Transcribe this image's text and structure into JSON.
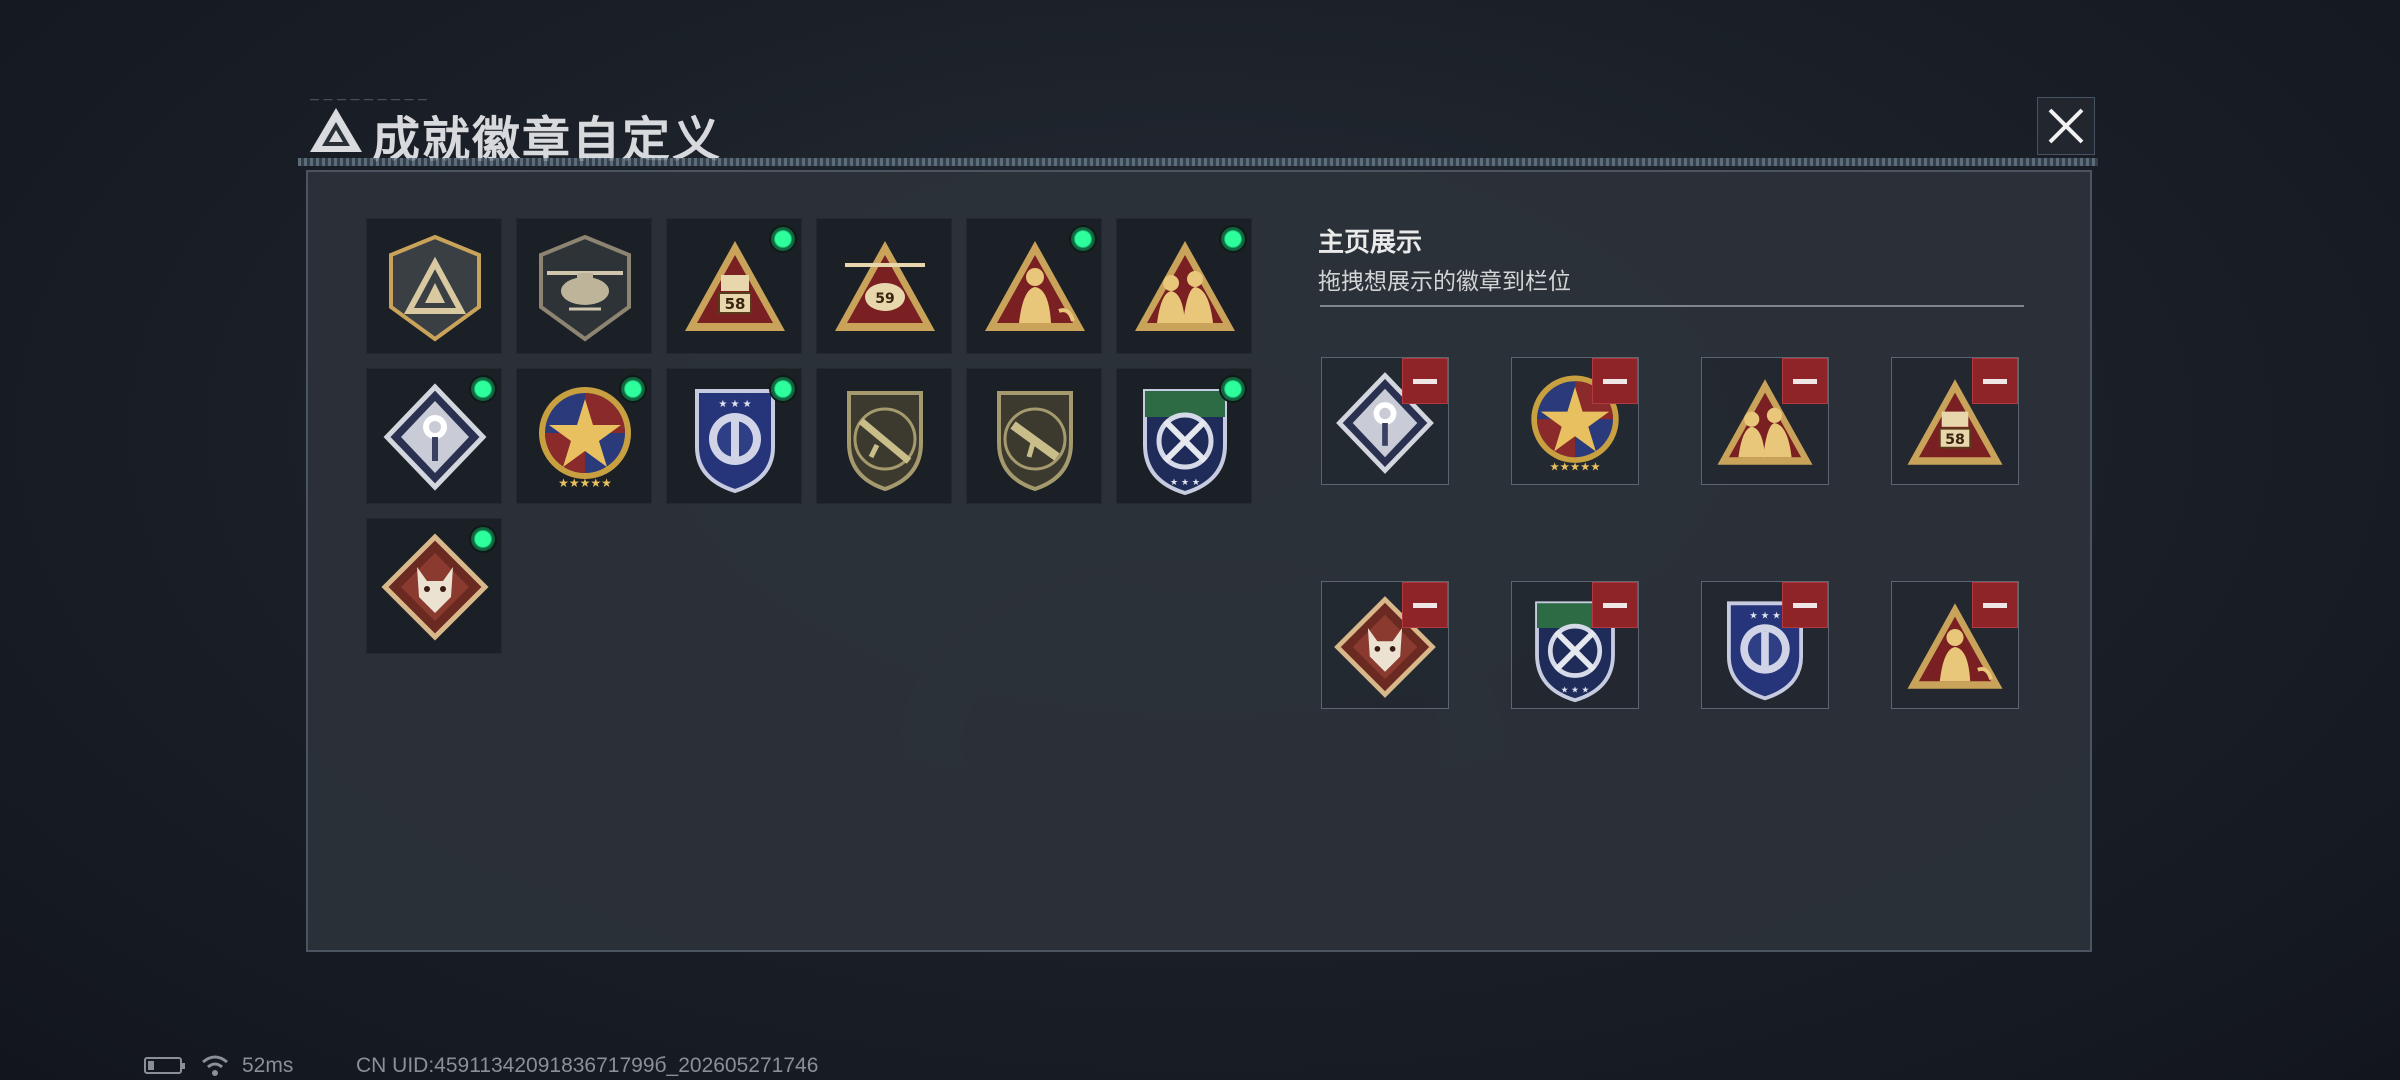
{
  "title": "成就徽章自定义",
  "title_tiny": "— — — — — — — — —",
  "showcase": {
    "heading": "主页展示",
    "hint": "拖拽想展示的徽章到栏位"
  },
  "colors": {
    "equipped_indicator": "#2cff9b",
    "remove_button": "#8e2428",
    "badge_gold": "#c9a35a",
    "badge_red": "#7a1f22",
    "badge_blue": "#2f3f86",
    "badge_green": "#2d6b45"
  },
  "collection": [
    {
      "icon": "triangle-logo-badge-icon",
      "equipped": false
    },
    {
      "icon": "helicopter-badge-icon",
      "equipped": false
    },
    {
      "icon": "triangle-58-badge-icon",
      "equipped": true,
      "label": "58"
    },
    {
      "icon": "triangle-59-badge-icon",
      "equipped": false,
      "label": "59"
    },
    {
      "icon": "triangle-soldier-badge-icon",
      "equipped": true
    },
    {
      "icon": "triangle-squad-badge-icon",
      "equipped": true
    },
    {
      "icon": "diamond-rose-badge-icon",
      "equipped": true
    },
    {
      "icon": "star-medal-badge-icon",
      "equipped": true
    },
    {
      "icon": "blue-shield-badge-icon",
      "equipped": true
    },
    {
      "icon": "rifle-shield-badge-icon",
      "equipped": false
    },
    {
      "icon": "smg-shield-badge-icon",
      "equipped": false
    },
    {
      "icon": "green-swords-badge-icon",
      "equipped": true
    },
    {
      "icon": "wolf-diamond-badge-icon",
      "equipped": true
    }
  ],
  "slots": [
    {
      "icon": "diamond-rose-badge-icon"
    },
    {
      "icon": "star-medal-badge-icon"
    },
    {
      "icon": "triangle-squad-badge-icon"
    },
    {
      "icon": "triangle-58-badge-icon",
      "label": "58"
    },
    {
      "icon": "wolf-diamond-badge-icon"
    },
    {
      "icon": "green-swords-badge-icon"
    },
    {
      "icon": "blue-shield-badge-icon"
    },
    {
      "icon": "triangle-soldier-badge-icon"
    }
  ],
  "status_bar": {
    "ping": "52ms",
    "uid": "CN UID:4591134209183671799б_202605271746"
  }
}
